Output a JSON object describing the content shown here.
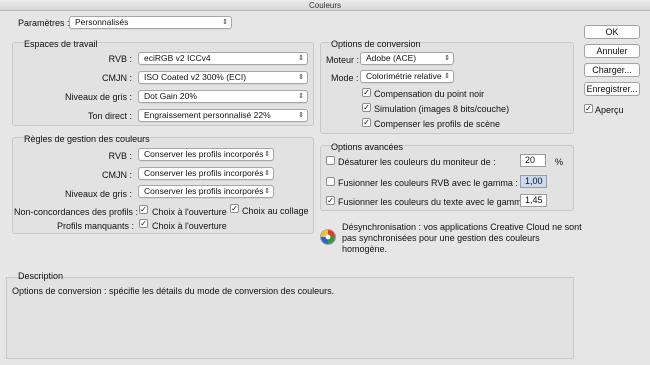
{
  "window": {
    "title": "Couleurs"
  },
  "settings": {
    "label": "Paramètres :",
    "value": "Personnalisés"
  },
  "working_spaces": {
    "title": "Espaces de travail",
    "rows": [
      {
        "label": "RVB :",
        "value": "eciRGB v2 ICCv4"
      },
      {
        "label": "CMJN :",
        "value": "ISO Coated v2 300% (ECI)"
      },
      {
        "label": "Niveaux de gris :",
        "value": "Dot Gain 20%"
      },
      {
        "label": "Ton direct :",
        "value": "Engraissement personnalisé 22%"
      }
    ]
  },
  "policies": {
    "title": "Règles de gestion des couleurs",
    "rows": [
      {
        "label": "RVB :",
        "value": "Conserver les profils incorporés"
      },
      {
        "label": "CMJN :",
        "value": "Conserver les profils incorporés"
      },
      {
        "label": "Niveaux de gris :",
        "value": "Conserver les profils incorporés"
      }
    ],
    "mismatch": {
      "label": "Non-concordances des profils :",
      "open_label": "Choix à l'ouverture",
      "paste_label": "Choix au collage"
    },
    "missing": {
      "label": "Profils manquants :",
      "open_label": "Choix à l'ouverture"
    }
  },
  "conversion": {
    "title": "Options de conversion",
    "engine": {
      "label": "Moteur :",
      "value": "Adobe (ACE)"
    },
    "intent": {
      "label": "Mode :",
      "value": "Colorimétrie relative"
    },
    "checks": [
      "Compensation du point noir",
      "Simulation (images 8 bits/couche)",
      "Compenser les profils de scène"
    ]
  },
  "advanced": {
    "title": "Options avancées",
    "desaturate": {
      "label": "Désaturer les couleurs du moniteur de :",
      "value": "20",
      "unit": "%"
    },
    "blend_rgb": {
      "label": "Fusionner les couleurs RVB avec le gamma :",
      "value": "1,00"
    },
    "blend_text": {
      "label": "Fusionner les couleurs du texte avec le gamma :",
      "value": "1,45"
    }
  },
  "sync": {
    "line1": "Désynchronisation : vos applications Creative Cloud ne sont",
    "line2": "pas synchronisées pour une gestion des couleurs",
    "line3": "homogène."
  },
  "description": {
    "title": "Description",
    "text": "Options de conversion : spécifie les détails du mode de conversion des couleurs."
  },
  "buttons": {
    "ok": "OK",
    "cancel": "Annuler",
    "load": "Charger...",
    "save": "Enregistrer...",
    "preview": "Aperçu"
  },
  "check_glyph": "✓",
  "arrow_glyph": "⇕"
}
